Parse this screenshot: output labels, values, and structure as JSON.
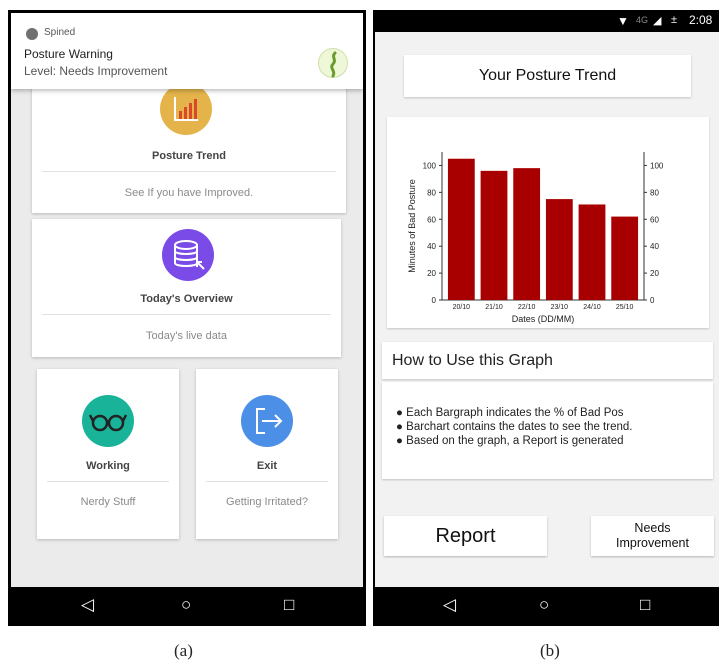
{
  "panel_a": {
    "notification": {
      "app_name": "Spined",
      "title": "Posture Warning",
      "level": "Level: Needs Improvement"
    },
    "cards": [
      {
        "title": "Posture Trend",
        "subtitle": "See If you have Improved.",
        "icon": "bar-chart-icon",
        "color": "#e4b44a"
      },
      {
        "title": "Today's Overview",
        "subtitle": "Today's live data",
        "icon": "database-icon",
        "color": "#7b4be8"
      },
      {
        "title": "Working",
        "subtitle": "Nerdy Stuff",
        "icon": "glasses-icon",
        "color": "#19b39a"
      },
      {
        "title": "Exit",
        "subtitle": "Getting Irritated?",
        "icon": "exit-icon",
        "color": "#4c8fe6"
      }
    ],
    "nav": {
      "back": "◁",
      "home": "○",
      "recent": "□"
    },
    "caption": "(a)"
  },
  "panel_b": {
    "status": {
      "network": "4G",
      "time": "2:08"
    },
    "header": "Your Posture Trend",
    "chart_data": {
      "type": "bar",
      "categories": [
        "20/10",
        "21/10",
        "22/10",
        "23/10",
        "24/10",
        "25/10"
      ],
      "values": [
        105,
        96,
        98,
        75,
        71,
        62
      ],
      "xlabel": "Dates (DD/MM)",
      "ylabel": "Minutes of Bad Posture",
      "ylim": [
        0,
        110
      ],
      "yticks": [
        0,
        20,
        40,
        60,
        80,
        100
      ],
      "bar_color": "#a80000",
      "grid": false
    },
    "help": {
      "title": "How to Use this Graph",
      "bullets": [
        "Each Bargraph indicates the % of Bad Pos",
        "Barchart contains the dates to see the trend.",
        "Based on the graph, a Report is generated"
      ]
    },
    "buttons": {
      "report": "Report",
      "needs_line1": "Needs",
      "needs_line2": "Improvement"
    },
    "nav": {
      "back": "◁",
      "home": "○",
      "recent": "□"
    },
    "caption": "(b)"
  }
}
